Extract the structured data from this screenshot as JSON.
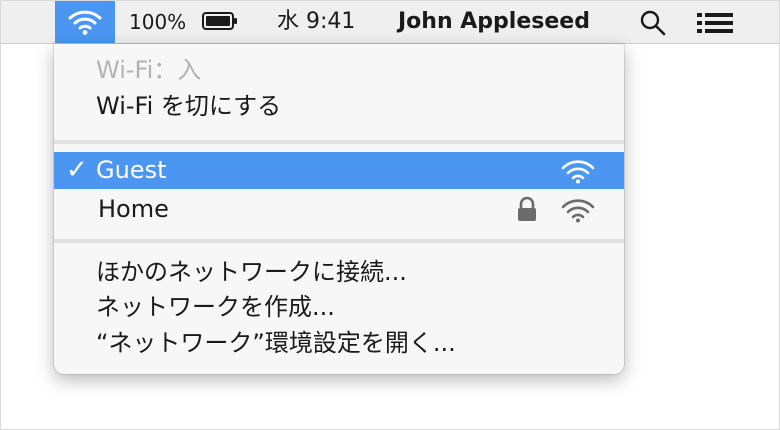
{
  "menubar": {
    "battery_percent": "100%",
    "clock": "水 9:41",
    "user_name": "John Appleseed",
    "icons": [
      "wifi-icon",
      "battery-icon",
      "spotlight-search-icon",
      "notification-list-icon"
    ]
  },
  "wifi_menu": {
    "status": "Wi-Fi：入",
    "toggle_label": "Wi-Fi を切にする",
    "networks": [
      {
        "name": "Guest",
        "selected": true,
        "locked": false,
        "icon": "wifi-signal-icon"
      },
      {
        "name": "Home",
        "selected": false,
        "locked": true,
        "icon": "wifi-signal-icon"
      }
    ],
    "check_mark": "✓",
    "actions": [
      "ほかのネットワークに接続...",
      "ネットワークを作成...",
      "“ネットワーク”環境設定を開く..."
    ]
  },
  "colors": {
    "highlight": "#4a96f0",
    "menubar_bg": "#efefef",
    "disabled_text": "#b3b3b3"
  }
}
